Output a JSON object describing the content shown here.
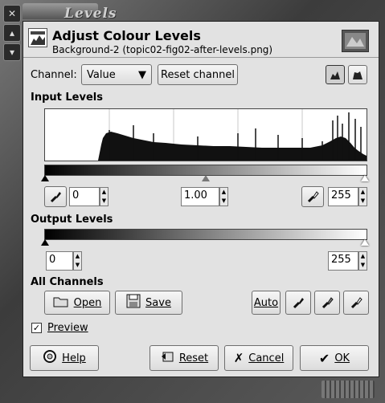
{
  "window": {
    "title": "Levels"
  },
  "header": {
    "title": "Adjust Colour Levels",
    "subtitle": "Background-2 (topic02-fig02-after-levels.png)"
  },
  "channel": {
    "label": "Channel:",
    "value": "Value",
    "reset_label": "Reset channel"
  },
  "input_levels": {
    "heading": "Input Levels",
    "low": "0",
    "gamma": "1.00",
    "high": "255"
  },
  "output_levels": {
    "heading": "Output Levels",
    "low": "0",
    "high": "255"
  },
  "all_channels": {
    "heading": "All Channels",
    "open_label": "Open",
    "save_label": "Save",
    "auto_label": "Auto"
  },
  "preview": {
    "label": "Preview",
    "checked": true
  },
  "footer": {
    "help_label": "Help",
    "reset_label": "Reset",
    "cancel_label": "Cancel",
    "ok_label": "OK"
  }
}
